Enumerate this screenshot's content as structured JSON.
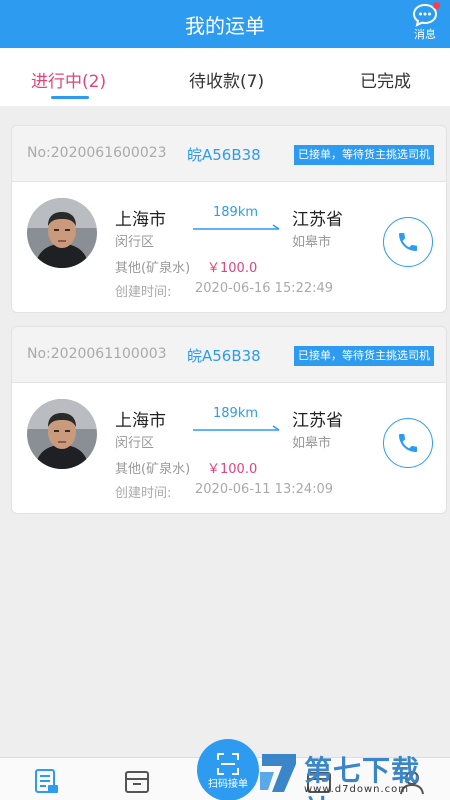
{
  "header": {
    "title": "我的运单",
    "message_label": "消息"
  },
  "tabs": [
    {
      "label": "进行中(2)",
      "active": true
    },
    {
      "label": "待收款(7)",
      "active": false
    },
    {
      "label": "已完成",
      "active": false
    }
  ],
  "orders": [
    {
      "order_no": "No:2020061600023",
      "plate": "皖A56B38",
      "status": "已接单，等待货主挑选司机",
      "from_city": "上海市",
      "from_district": "闵行区",
      "distance": "189km",
      "to_city": "江苏省",
      "to_district": "如皋市",
      "cargo": "其他(矿泉水)",
      "price": "￥100.0",
      "created_label": "创建时间:",
      "created_time": "2020-06-16 15:22:49"
    },
    {
      "order_no": "No:2020061100003",
      "plate": "皖A56B38",
      "status": "已接单，等待货主挑选司机",
      "from_city": "上海市",
      "from_district": "闵行区",
      "distance": "189km",
      "to_city": "江苏省",
      "to_district": "如皋市",
      "cargo": "其他(矿泉水)",
      "price": "￥100.0",
      "created_label": "创建时间:",
      "created_time": "2020-06-11 13:24:09"
    }
  ],
  "bottom_nav": {
    "scan_label": "扫码接单"
  },
  "watermark": {
    "title": "第七下载站",
    "url": "www.d7down.com"
  },
  "colors": {
    "primary": "#2d9cf0",
    "accent": "#e2457a",
    "background": "#eeeeee"
  }
}
